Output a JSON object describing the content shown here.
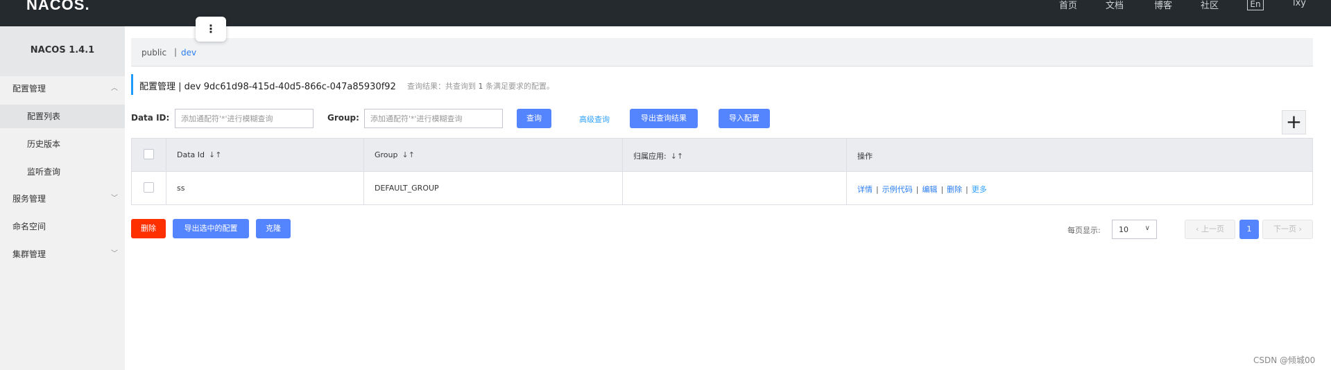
{
  "header": {
    "logo": "NACOS.",
    "nav": [
      "首页",
      "文档",
      "博客",
      "社区"
    ],
    "lang": "En",
    "user": "lxy"
  },
  "sidebar": {
    "version": "NACOS 1.4.1",
    "items": [
      {
        "label": "配置管理",
        "caret": "^"
      },
      {
        "label": "配置列表"
      },
      {
        "label": "历史版本"
      },
      {
        "label": "监听查询"
      },
      {
        "label": "服务管理",
        "caret": "v"
      },
      {
        "label": "命名空间"
      },
      {
        "label": "集群管理",
        "caret": "v"
      }
    ]
  },
  "float_menu": {
    "icon": "more-vertical-icon",
    "glyph": "⋮"
  },
  "namespace": {
    "public": "public",
    "separator": "|",
    "dev": "dev"
  },
  "title": {
    "text": "配置管理 | dev 9dc61d98-415d-40d5-866c-047a85930f92",
    "result_prefix": "查询结果：共查询到",
    "result_count": "1",
    "result_suffix": "条满足要求的配置。"
  },
  "search": {
    "data_id_label": "Data ID:",
    "data_id_placeholder": "添加通配符'*'进行模糊查询",
    "group_label": "Group:",
    "group_placeholder": "添加通配符'*'进行模糊查询",
    "query_button": "查询",
    "advanced_query": "高级查询",
    "export_results_button": "导出查询结果",
    "import_button": "导入配置",
    "add_icon": "plus-icon",
    "add_glyph": "+"
  },
  "table": {
    "headers": {
      "data_id": "Data Id",
      "group": "Group",
      "app": "归属应用:",
      "ops": "操作",
      "sort_glyph": "↓↑"
    },
    "rows": [
      {
        "data_id": "ss",
        "group": "DEFAULT_GROUP",
        "app": "",
        "ops": {
          "detail": "详情",
          "sample": "示例代码",
          "edit": "编辑",
          "delete": "删除",
          "more": "更多",
          "sep": "|"
        }
      }
    ]
  },
  "bulk": {
    "delete_button": "删除",
    "export_selected_button": "导出选中的配置",
    "clone_button": "克隆"
  },
  "pagination": {
    "page_size_label": "每页显示:",
    "page_size": "10",
    "prev": "上一页",
    "current_page": "1",
    "next": "下一页"
  },
  "watermark": "CSDN @倾城00",
  "colors": {
    "topbar": "#252a2f",
    "primary": "#5584ff",
    "danger": "#ff3000",
    "link": "#2a7df0",
    "accent_line": "#209bfa"
  }
}
